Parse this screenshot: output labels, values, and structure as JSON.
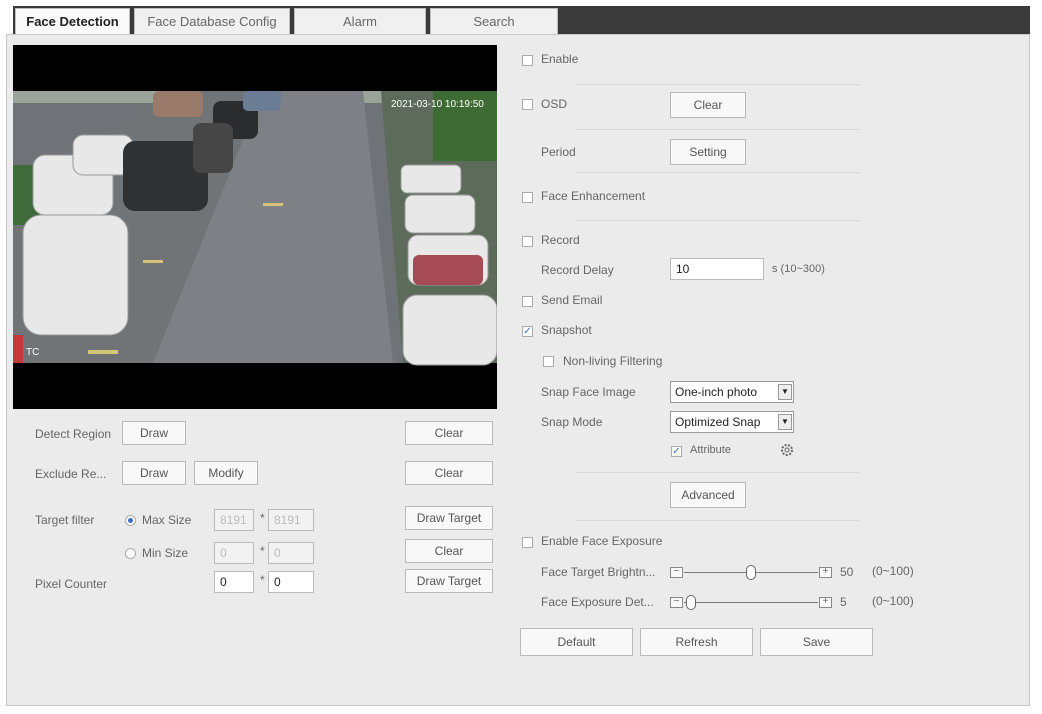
{
  "tabs": [
    {
      "label": "Face Detection",
      "active": true
    },
    {
      "label": "Face Database Config",
      "active": false
    },
    {
      "label": "Alarm",
      "active": false
    },
    {
      "label": "Search",
      "active": false
    }
  ],
  "video": {
    "timestamp": "2021-03-10 10:19:50",
    "corner": "TC"
  },
  "left": {
    "detect_region": {
      "label": "Detect Region",
      "draw": "Draw",
      "clear": "Clear"
    },
    "exclude_region": {
      "label": "Exclude Re...",
      "draw": "Draw",
      "modify": "Modify",
      "clear": "Clear"
    },
    "target_filter": {
      "label": "Target filter",
      "max_label": "Max Size",
      "max_w": "8191",
      "max_h": "8191",
      "min_label": "Min Size",
      "min_w": "0",
      "min_h": "0",
      "draw_target": "Draw Target",
      "clear": "Clear"
    },
    "pixel_counter": {
      "label": "Pixel Counter",
      "w": "0",
      "h": "0",
      "draw_target": "Draw Target"
    },
    "times": "*"
  },
  "right": {
    "enable": {
      "label": "Enable",
      "checked": false
    },
    "osd": {
      "label": "OSD",
      "checked": false,
      "clear": "Clear"
    },
    "period": {
      "label": "Period",
      "setting": "Setting"
    },
    "face_enhancement": {
      "label": "Face Enhancement",
      "checked": false
    },
    "record": {
      "label": "Record",
      "checked": false
    },
    "record_delay": {
      "label": "Record Delay",
      "value": "10",
      "range": "s (10~300)"
    },
    "send_email": {
      "label": "Send Email",
      "checked": false
    },
    "snapshot": {
      "label": "Snapshot",
      "checked": true
    },
    "non_living": {
      "label": "Non-living Filtering",
      "checked": false
    },
    "snap_face_image": {
      "label": "Snap Face Image",
      "value": "One-inch photo"
    },
    "snap_mode": {
      "label": "Snap Mode",
      "value": "Optimized Snap"
    },
    "attribute": {
      "label": "Attribute",
      "checked": true
    },
    "advanced": "Advanced",
    "face_exposure": {
      "label": "Enable Face Exposure",
      "checked": false
    },
    "brightness": {
      "label": "Face Target Brightn...",
      "value": "50",
      "range": "(0~100)",
      "level": 0.5
    },
    "exposure_det": {
      "label": "Face Exposure Det...",
      "value": "5",
      "range": "(0~100)",
      "level": 0.05
    },
    "buttons": {
      "default": "Default",
      "refresh": "Refresh",
      "save": "Save"
    }
  }
}
